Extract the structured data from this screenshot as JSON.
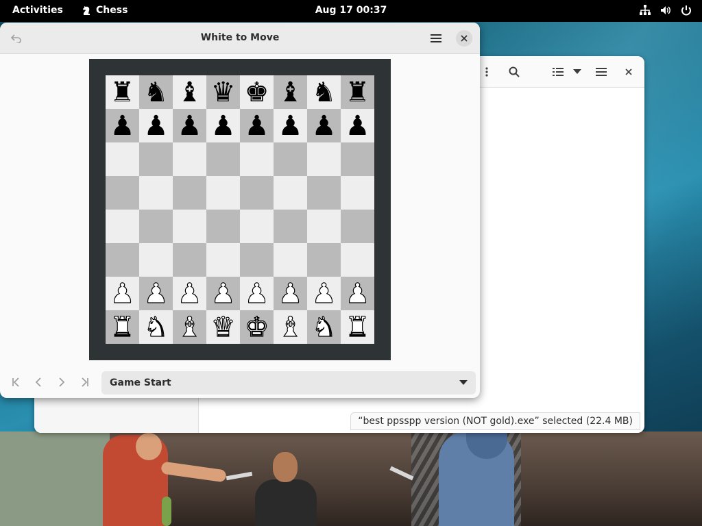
{
  "topbar": {
    "activities": "Activities",
    "app_name": "Chess",
    "app_icon": "chess-knight-icon",
    "clock": "Aug 17  00:37",
    "tray_icons": [
      "network-icon",
      "volume-icon",
      "power-icon"
    ]
  },
  "files_window": {
    "header_icons": [
      "view-options-icon",
      "search-icon",
      "list-view-icon",
      "dropdown-arrow-icon",
      "menu-icon",
      "close-icon"
    ],
    "status": "“best ppsspp version (NOT gold).exe” selected  (22.4 MB)"
  },
  "chess_window": {
    "title": "White to Move",
    "back_icon": "undo-icon",
    "menu_icon": "hamburger-menu-icon",
    "close_icon": "close-icon",
    "board": {
      "light_color": "#eeeeee",
      "dark_color": "#bababa",
      "frame_color": "#2e3436",
      "ranks": [
        [
          "br",
          "bn",
          "bb",
          "bq",
          "bk",
          "bb",
          "bn",
          "br"
        ],
        [
          "bp",
          "bp",
          "bp",
          "bp",
          "bp",
          "bp",
          "bp",
          "bp"
        ],
        [
          "",
          "",
          "",
          "",
          "",
          "",
          "",
          ""
        ],
        [
          "",
          "",
          "",
          "",
          "",
          "",
          "",
          ""
        ],
        [
          "",
          "",
          "",
          "",
          "",
          "",
          "",
          ""
        ],
        [
          "",
          "",
          "",
          "",
          "",
          "",
          "",
          ""
        ],
        [
          "wp",
          "wp",
          "wp",
          "wp",
          "wp",
          "wp",
          "wp",
          "wp"
        ],
        [
          "wr",
          "wn",
          "wb",
          "wq",
          "wk",
          "wb",
          "wn",
          "wr"
        ]
      ]
    },
    "history_nav_icons": [
      "go-first-icon",
      "go-previous-icon",
      "go-next-icon",
      "go-last-icon"
    ],
    "move_selector": "Game Start"
  }
}
